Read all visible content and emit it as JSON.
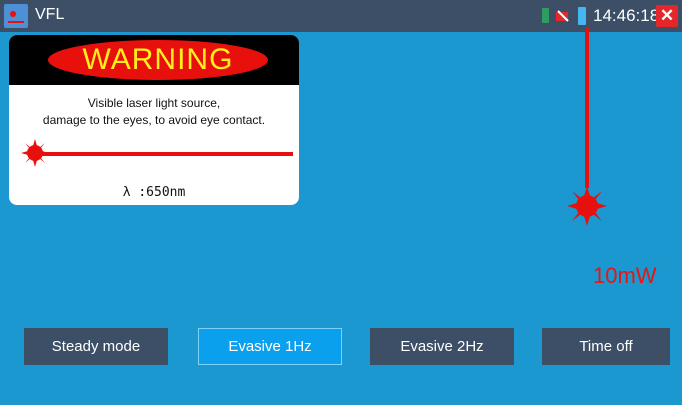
{
  "titlebar": {
    "title": "VFL",
    "app_icon": "vfl-app-icon",
    "clock": "14:46:18",
    "close_label": "✕"
  },
  "warning": {
    "header": "WARNING",
    "line1": "Visible laser light source,",
    "line2": "damage to the eyes, to avoid eye contact.",
    "wavelength": "λ :650nm"
  },
  "laser": {
    "power": "10mW"
  },
  "modes": {
    "steady": "Steady mode",
    "evasive1": "Evasive 1Hz",
    "evasive2": "Evasive 2Hz",
    "timeoff": "Time off",
    "selected": "Evasive 1Hz"
  },
  "colors": {
    "background": "#1a98cf",
    "titlebar": "#3d4f66",
    "button": "#3d4f66",
    "button_active": "#0aa0ee",
    "laser_red": "#e8100d",
    "warning_yellow": "#ffef1a"
  }
}
